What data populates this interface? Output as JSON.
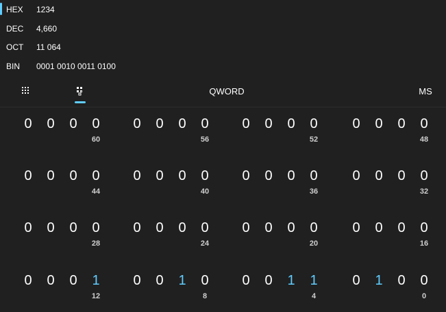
{
  "radix": [
    {
      "name": "HEX",
      "value": "1234",
      "selected": true
    },
    {
      "name": "DEC",
      "value": "4,660",
      "selected": false
    },
    {
      "name": "OCT",
      "value": "11 064",
      "selected": false
    },
    {
      "name": "BIN",
      "value": "0001 0010 0011 0100",
      "selected": false
    }
  ],
  "toolbar": {
    "keypad_icon": "full-keypad-icon",
    "bit_toggle_icon": "bit-toggling-keypad-icon",
    "word_size": "QWORD",
    "memory_label": "MS"
  },
  "colors": {
    "background": "#202020",
    "accent": "#60cdff",
    "text": "#ffffff",
    "label": "#cfcfcf"
  },
  "bits": {
    "rows": [
      {
        "nibbles": [
          {
            "bits": [
              "0",
              "0",
              "0",
              "0"
            ],
            "label": "60"
          },
          {
            "bits": [
              "0",
              "0",
              "0",
              "0"
            ],
            "label": "56"
          },
          {
            "bits": [
              "0",
              "0",
              "0",
              "0"
            ],
            "label": "52"
          },
          {
            "bits": [
              "0",
              "0",
              "0",
              "0"
            ],
            "label": "48"
          }
        ]
      },
      {
        "nibbles": [
          {
            "bits": [
              "0",
              "0",
              "0",
              "0"
            ],
            "label": "44"
          },
          {
            "bits": [
              "0",
              "0",
              "0",
              "0"
            ],
            "label": "40"
          },
          {
            "bits": [
              "0",
              "0",
              "0",
              "0"
            ],
            "label": "36"
          },
          {
            "bits": [
              "0",
              "0",
              "0",
              "0"
            ],
            "label": "32"
          }
        ]
      },
      {
        "nibbles": [
          {
            "bits": [
              "0",
              "0",
              "0",
              "0"
            ],
            "label": "28"
          },
          {
            "bits": [
              "0",
              "0",
              "0",
              "0"
            ],
            "label": "24"
          },
          {
            "bits": [
              "0",
              "0",
              "0",
              "0"
            ],
            "label": "20"
          },
          {
            "bits": [
              "0",
              "0",
              "0",
              "0"
            ],
            "label": "16"
          }
        ]
      },
      {
        "nibbles": [
          {
            "bits": [
              "0",
              "0",
              "0",
              "1"
            ],
            "label": "12"
          },
          {
            "bits": [
              "0",
              "0",
              "1",
              "0"
            ],
            "label": "8"
          },
          {
            "bits": [
              "0",
              "0",
              "1",
              "1"
            ],
            "label": "4"
          },
          {
            "bits": [
              "0",
              "1",
              "0",
              "0"
            ],
            "label": "0"
          }
        ]
      }
    ]
  }
}
